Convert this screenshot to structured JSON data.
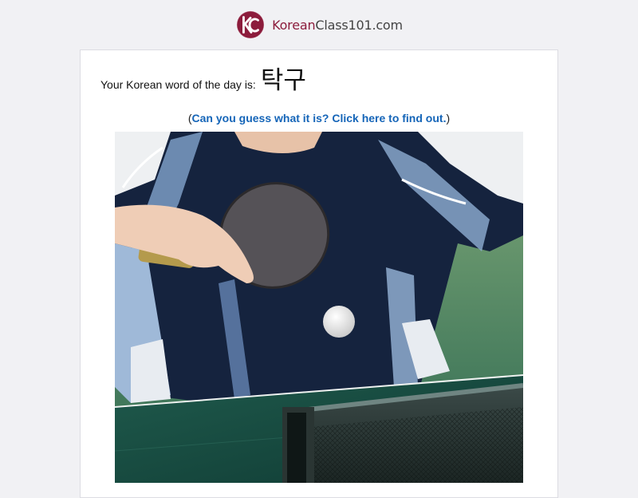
{
  "header": {
    "logo_brand": "Korean",
    "logo_rest": "Class101.com",
    "logo_monogram": "KC"
  },
  "wotd": {
    "prefix": "Your Korean word of the day is:",
    "word": "탁구"
  },
  "guess": {
    "open_paren": "(",
    "link_text": "Can you guess what it is? Click here to find out.",
    "close_paren": ")"
  },
  "photo": {
    "description_icon": "table-tennis-photo"
  },
  "colors": {
    "brand": "#8c1c3c",
    "link": "#1565b8",
    "background": "#f1f1f4"
  }
}
